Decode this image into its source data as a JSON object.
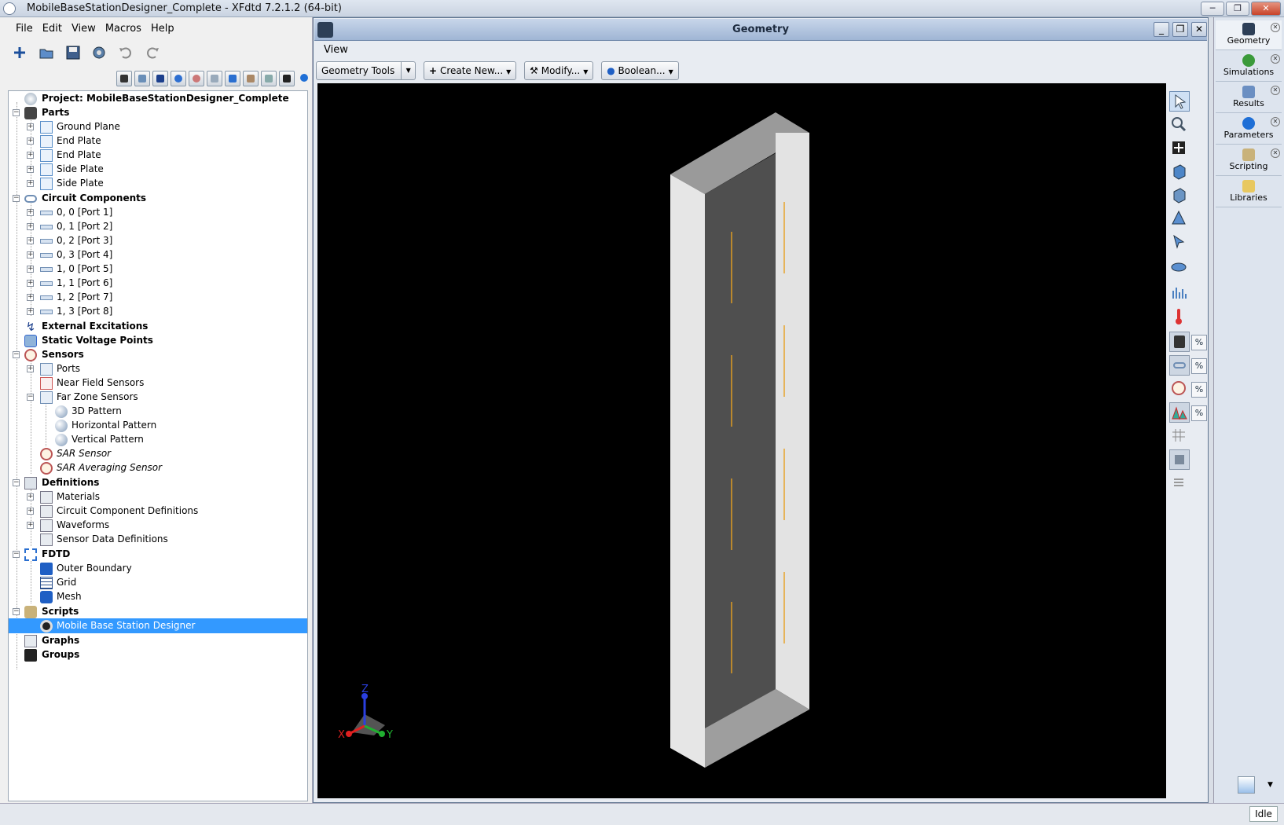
{
  "window": {
    "title": "MobileBaseStationDesigner_Complete - XFdtd 7.2.1.2 (64-bit)"
  },
  "menu": {
    "file": "File",
    "edit": "Edit",
    "view": "View",
    "macros": "Macros",
    "help": "Help"
  },
  "toolbar": {
    "buttons": [
      "new-icon",
      "open-icon",
      "save-icon",
      "settings-icon",
      "undo-icon",
      "redo-icon"
    ],
    "tree_filters": [
      "geometry-filter-icon",
      "circuit-filter-icon",
      "excitation-filter-icon",
      "voltage-filter-icon",
      "sensor-filter-icon",
      "definitions-filter-icon",
      "fdtd-filter-icon",
      "scripts-filter-icon",
      "graphs-filter-icon",
      "groups-filter-icon",
      "sync-icon"
    ]
  },
  "tree": {
    "project": "Project: MobileBaseStationDesigner_Complete",
    "parts": "Parts",
    "parts_items": [
      "Ground Plane",
      "End Plate",
      "End Plate",
      "Side Plate",
      "Side Plate"
    ],
    "circuit": "Circuit Components",
    "circuit_items": [
      "0, 0 [Port 1]",
      "0, 1 [Port 2]",
      "0, 2 [Port 3]",
      "0, 3 [Port 4]",
      "1, 0 [Port 5]",
      "1, 1 [Port 6]",
      "1, 2 [Port 7]",
      "1, 3 [Port 8]"
    ],
    "external": "External Excitations",
    "static": "Static Voltage Points",
    "sensors": "Sensors",
    "ports": "Ports",
    "near_field": "Near Field Sensors",
    "far_zone": "Far Zone Sensors",
    "pattern_3d": "3D Pattern",
    "pattern_h": "Horizontal Pattern",
    "pattern_v": "Vertical Pattern",
    "sar": "SAR Sensor",
    "sar_avg": "SAR Averaging Sensor",
    "definitions": "Definitions",
    "materials": "Materials",
    "ccd": "Circuit Component Definitions",
    "waveforms": "Waveforms",
    "sdd": "Sensor Data Definitions",
    "fdtd": "FDTD",
    "outer": "Outer Boundary",
    "grid": "Grid",
    "mesh": "Mesh",
    "scripts": "Scripts",
    "mbsd": "Mobile Base Station Designer",
    "graphs": "Graphs",
    "groups": "Groups"
  },
  "geometry": {
    "title": "Geometry",
    "view_menu": "View",
    "tools": "Geometry Tools",
    "create": "Create New...",
    "modify": "Modify...",
    "boolean": "Boolean...",
    "axes": {
      "x": "X",
      "y": "Y",
      "z": "Z"
    },
    "pct": "%"
  },
  "side_tabs": [
    "Geometry",
    "Simulations",
    "Results",
    "Parameters",
    "Scripting",
    "Libraries"
  ],
  "status": {
    "state": "Idle"
  },
  "colors": {
    "selection": "#3399ff",
    "canvas": "#000000",
    "port_line": "#f0a000"
  }
}
